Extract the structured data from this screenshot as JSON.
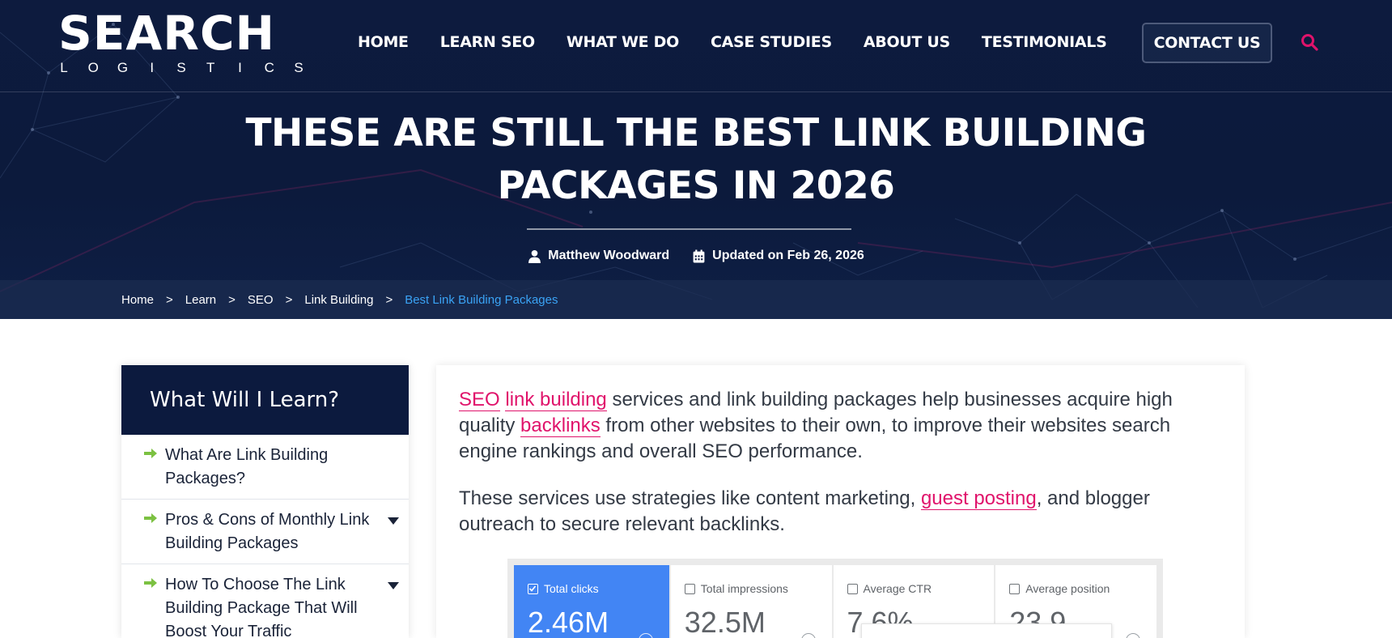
{
  "brand": {
    "name": "SEARCH",
    "tagline_letters": [
      "L",
      "O",
      "G",
      "I",
      "S",
      "T",
      "I",
      "C",
      "S"
    ]
  },
  "colors": {
    "hero_bg": "#0d1b3e",
    "accent_pink": "#e0136b",
    "breadcrumb_current": "#3aa3f5",
    "arrow_green": "#7cc142",
    "gsc_blue": "#4285f4"
  },
  "nav": {
    "items": [
      {
        "label": "HOME"
      },
      {
        "label": "LEARN SEO"
      },
      {
        "label": "WHAT WE DO"
      },
      {
        "label": "CASE STUDIES"
      },
      {
        "label": "ABOUT US"
      },
      {
        "label": "TESTIMONIALS"
      }
    ],
    "contact_label": "CONTACT US",
    "search_icon": "search-icon"
  },
  "hero": {
    "title_line1": "THESE ARE STILL THE BEST LINK BUILDING",
    "title_line2": "PACKAGES IN 2026",
    "author": "Matthew Woodward",
    "updated": "Updated on Feb 26, 2026",
    "author_icon": "user-icon",
    "date_icon": "calendar-icon"
  },
  "breadcrumb": {
    "items": [
      "Home",
      "Learn",
      "SEO",
      "Link Building"
    ],
    "current": "Best Link Building Packages",
    "separator": ">"
  },
  "sidebar": {
    "title": "What Will I Learn?",
    "items": [
      {
        "label": "What Are Link Building Packages?",
        "expandable": false
      },
      {
        "label": "Pros & Cons of Monthly Link Building Packages",
        "expandable": true
      },
      {
        "label": "How To Choose The Link Building Package That Will Boost Your Traffic",
        "expandable": true
      }
    ]
  },
  "article": {
    "p1": {
      "link1": "SEO",
      "link2": "link building",
      "text1": " services and link building packages help businesses acquire high quality ",
      "link3": "backlinks",
      "text2": " from other websites to their own, to improve their websites search engine rankings and overall SEO performance."
    },
    "p2": {
      "text1": "These services use strategies like content marketing, ",
      "link1": "guest posting",
      "text2": ", and blogger outreach to secure relevant backlinks."
    },
    "gsc": [
      {
        "label": "Total clicks",
        "value": "2.46M",
        "checked": true
      },
      {
        "label": "Total impressions",
        "value": "32.5M",
        "checked": false
      },
      {
        "label": "Average CTR",
        "value": "7.6%",
        "checked": false
      },
      {
        "label": "Average position",
        "value": "23.9",
        "checked": false
      }
    ]
  }
}
